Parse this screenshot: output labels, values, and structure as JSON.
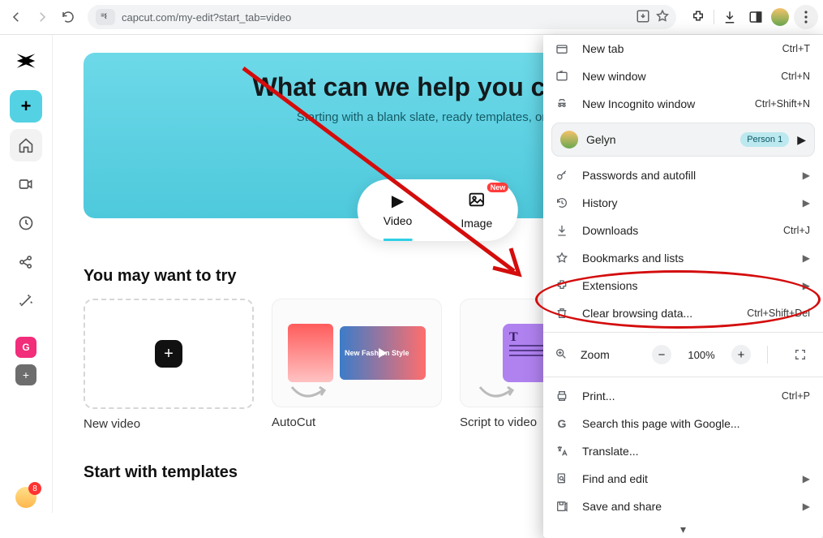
{
  "browser": {
    "url": "capcut.com/my-edit?start_tab=video"
  },
  "sidebar": {
    "chip_letter": "G",
    "notif_count": "8"
  },
  "hero": {
    "title": "What can we help you create?",
    "subtitle": "Starting with a blank slate, ready templates, or some",
    "tabs": {
      "video": "Video",
      "image": "Image",
      "new_badge": "New"
    }
  },
  "sections": {
    "try_title": "You may want to try",
    "templates_title": "Start with templates",
    "cards": {
      "newvideo": "New video",
      "autocut": "AutoCut",
      "autocut_caption": "New Fashion Style",
      "script": "Script to video"
    }
  },
  "menu": {
    "new_tab": {
      "label": "New tab",
      "shortcut": "Ctrl+T"
    },
    "new_window": {
      "label": "New window",
      "shortcut": "Ctrl+N"
    },
    "new_incognito": {
      "label": "New Incognito window",
      "shortcut": "Ctrl+Shift+N"
    },
    "profile": {
      "name": "Gelyn",
      "badge": "Person 1"
    },
    "passwords": {
      "label": "Passwords and autofill"
    },
    "history": {
      "label": "History"
    },
    "downloads": {
      "label": "Downloads",
      "shortcut": "Ctrl+J"
    },
    "bookmarks": {
      "label": "Bookmarks and lists"
    },
    "extensions": {
      "label": "Extensions"
    },
    "clear": {
      "label": "Clear browsing data...",
      "shortcut": "Ctrl+Shift+Del"
    },
    "zoom": {
      "label": "Zoom",
      "value": "100%"
    },
    "print": {
      "label": "Print...",
      "shortcut": "Ctrl+P"
    },
    "search_google": {
      "label": "Search this page with Google..."
    },
    "translate": {
      "label": "Translate..."
    },
    "find_edit": {
      "label": "Find and edit"
    },
    "save_share": {
      "label": "Save and share"
    }
  }
}
